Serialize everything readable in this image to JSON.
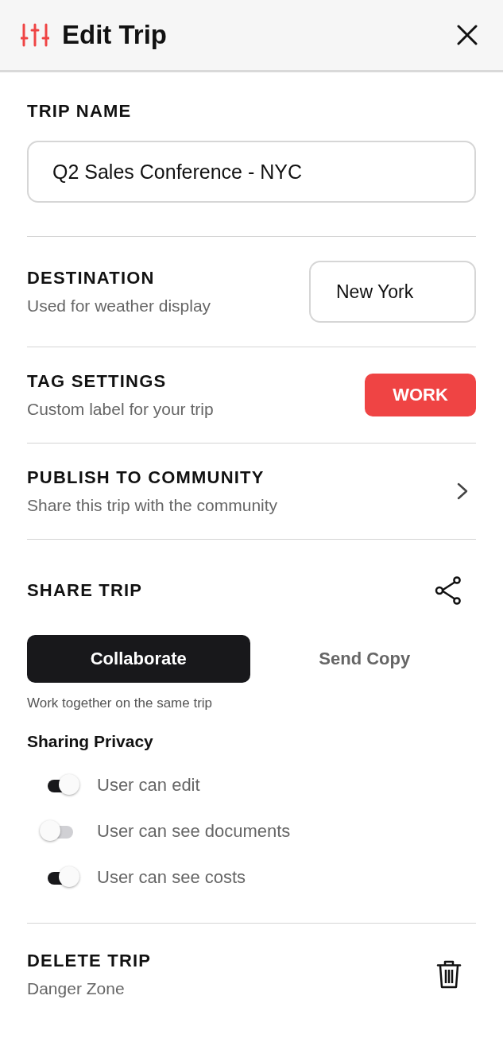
{
  "header": {
    "title": "Edit Trip"
  },
  "trip_name": {
    "label": "TRIP NAME",
    "value": "Q2 Sales Conference - NYC"
  },
  "settings": [
    {
      "kind": "field",
      "title": "DESTINATION",
      "subtitle": "Used for weather display",
      "value": "New York"
    },
    {
      "kind": "tag",
      "title": "TAG SETTINGS",
      "subtitle": "Custom label for your trip",
      "value": "WORK"
    },
    {
      "kind": "link",
      "title": "PUBLISH TO COMMUNITY",
      "subtitle": "Share this trip with the community"
    }
  ],
  "share": {
    "title": "SHARE TRIP",
    "modes": [
      {
        "label": "Collaborate",
        "selected": true
      },
      {
        "label": "Send Copy",
        "selected": false
      }
    ],
    "description": "Work together on the same trip",
    "privacy_title": "Sharing Privacy",
    "toggles": [
      {
        "label": "User can edit",
        "on": true
      },
      {
        "label": "User can see documents",
        "on": false
      },
      {
        "label": "User can see costs",
        "on": true
      }
    ]
  },
  "delete": {
    "title": "DELETE TRIP",
    "subtitle": "Danger Zone"
  }
}
